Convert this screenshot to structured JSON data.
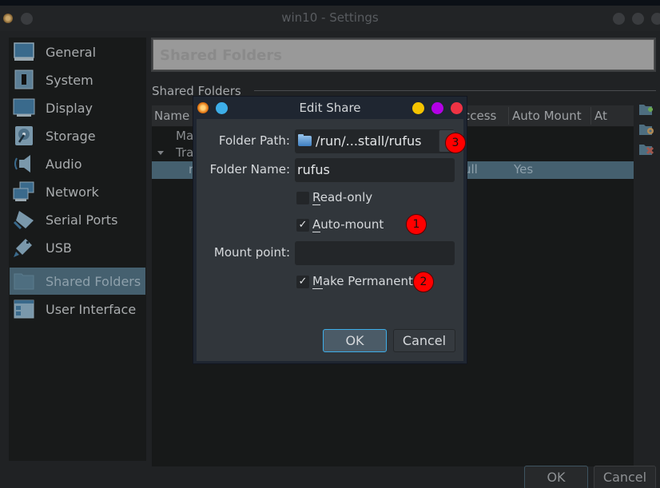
{
  "window": {
    "title": "win10 - Settings"
  },
  "sidebar": {
    "items": [
      {
        "label": "General",
        "icon": "general-icon"
      },
      {
        "label": "System",
        "icon": "system-chip-icon"
      },
      {
        "label": "Display",
        "icon": "display-monitor-icon"
      },
      {
        "label": "Storage",
        "icon": "storage-disk-icon"
      },
      {
        "label": "Audio",
        "icon": "audio-speaker-icon"
      },
      {
        "label": "Network",
        "icon": "network-icon"
      },
      {
        "label": "Serial Ports",
        "icon": "serial-port-icon"
      },
      {
        "label": "USB",
        "icon": "usb-icon"
      },
      {
        "label": "Shared Folders",
        "icon": "shared-folder-icon",
        "selected": true
      },
      {
        "label": "User Interface",
        "icon": "user-interface-icon"
      }
    ]
  },
  "page": {
    "header": "Shared Folders",
    "group_label_prefix": "Shared ",
    "group_label_mnemonic": "F",
    "group_label_suffix": "olders"
  },
  "table": {
    "columns": [
      "Name",
      "Access",
      "Auto Mount",
      "At"
    ],
    "rows": [
      {
        "name": "Ma",
        "access": "",
        "auto_mount": "",
        "at": "",
        "indent": 1
      },
      {
        "name": "Tra",
        "access": "",
        "auto_mount": "",
        "at": "",
        "indent": 0,
        "expanded": true
      },
      {
        "name": "r",
        "access": "ull",
        "auto_mount": "Yes",
        "at": "",
        "indent": 2,
        "selected": true
      }
    ],
    "tools": [
      "add-shared-folder-icon",
      "edit-shared-folder-icon",
      "remove-shared-folder-icon"
    ]
  },
  "buttons": {
    "ok": "OK",
    "cancel": "Cancel"
  },
  "dialog": {
    "title": "Edit Share",
    "folder_path_label": "Folder Path:",
    "folder_path_value": "/run/...stall/rufus",
    "folder_name_label": "Folder Name:",
    "folder_name_value": "rufus",
    "read_only": {
      "mnemonic": "R",
      "rest": "ead-only",
      "checked": false
    },
    "auto_mount": {
      "mnemonic": "A",
      "rest": "uto-mount",
      "checked": true
    },
    "mount_point_label": "Mount point:",
    "mount_point_value": "",
    "make_permanent": {
      "mnemonic": "M",
      "rest": "ake Permanent",
      "checked": true
    },
    "check_glyph": "✓",
    "ok": "OK",
    "cancel": "Cancel",
    "colors": {
      "dot_blue": "#3daee9",
      "dot_yellow": "#f5c400",
      "dot_purple": "#b300e6",
      "dot_red": "#ee3344",
      "focus": "#3daee9"
    }
  },
  "annotations": [
    {
      "label": "1",
      "target": "auto-mount-checkbox"
    },
    {
      "label": "2",
      "target": "make-permanent-checkbox"
    },
    {
      "label": "3",
      "target": "folder-path-combo"
    }
  ]
}
